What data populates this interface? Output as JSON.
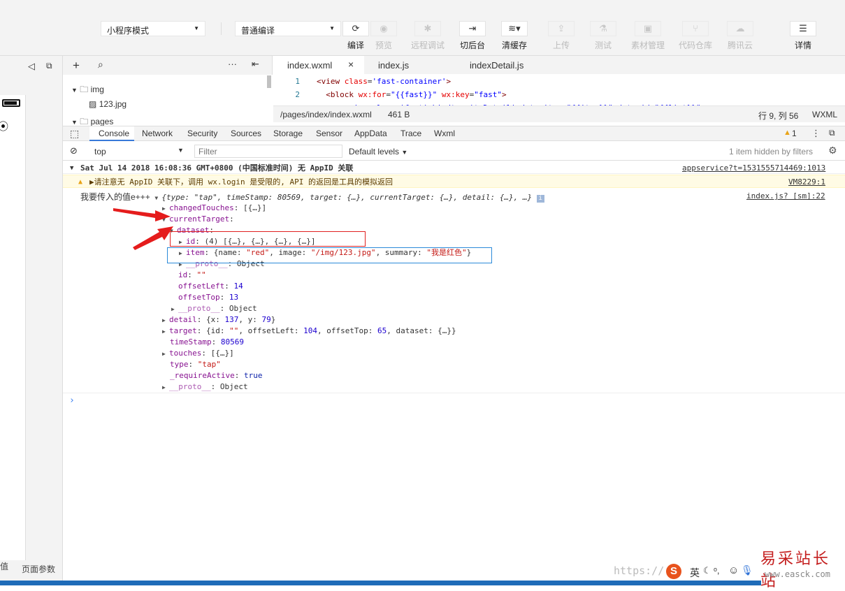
{
  "toolbar": {
    "mode_select": "小程序模式",
    "compile_select": "普通编译",
    "buttons": [
      {
        "label": "编译",
        "icon": "refresh-icon"
      },
      {
        "label": "预览",
        "icon": "eye-icon"
      },
      {
        "label": "远程调试",
        "icon": "bug-icon"
      },
      {
        "label": "切后台",
        "icon": "switch-background-icon"
      },
      {
        "label": "清缓存",
        "icon": "layers-icon"
      },
      {
        "label": "上传",
        "icon": "upload-icon"
      },
      {
        "label": "测试",
        "icon": "flask-icon"
      },
      {
        "label": "素材管理",
        "icon": "folder-icon"
      },
      {
        "label": "代码仓库",
        "icon": "branch-icon"
      },
      {
        "label": "腾讯云",
        "icon": "cloud-icon"
      },
      {
        "label": "详情",
        "icon": "menu-icon"
      }
    ]
  },
  "filetree": {
    "items": [
      {
        "name": "img",
        "type": "folder"
      },
      {
        "name": "123.jpg",
        "type": "image"
      },
      {
        "name": "pages",
        "type": "folder"
      }
    ]
  },
  "editor": {
    "tabs": [
      "index.wxml",
      "index.js",
      "indexDetail.js"
    ],
    "close_glyph": "×",
    "lines": [
      {
        "no": "1",
        "code": "<view class='fast-container'>"
      },
      {
        "no": "2",
        "code": "  <block wx:for=\"{{fast}}\" wx:key=\"fast\">"
      }
    ],
    "status": {
      "path": "/pages/index/index.wxml",
      "size": "461 B",
      "position": "行 9, 列 56",
      "lang": "WXML"
    }
  },
  "devtools": {
    "tabs": [
      "Console",
      "Network",
      "Security",
      "Sources",
      "Storage",
      "Sensor",
      "AppData",
      "Trace",
      "Wxml"
    ],
    "active_tab": "Console",
    "warning_count": "1",
    "context": "top",
    "filter_placeholder": "Filter",
    "levels": "Default levels",
    "hidden_note": "1 item hidden by filters",
    "group_header": "Sat Jul 14 2018 16:08:36 GMT+0800 (中国标准时间) 无 AppID 关联",
    "group_source": "appservice?t=1531555714469:1013",
    "warning_msg_prefix": "请注意无 AppID 关联下，调用",
    "warning_msg_code": "wx.login",
    "warning_msg_suffix": "是受限的, API 的返回是工具的模拟返回",
    "warning_source": "VM8229:1",
    "log_prefix": "我要传入的值e+++",
    "log_summary": "{type: \"tap\", timeStamp: 80569, target: {…}, currentTarget: {…}, detail: {…}, …}",
    "log_source": "index.js? [sm]:22"
  },
  "sidebar": {
    "bottom_left": "值",
    "bottom_tab": "页面参数"
  },
  "watermark": {
    "text": "易采站长站",
    "url": "www.easck.com",
    "url_partial": "https://"
  },
  "ime": {
    "lang": "英"
  }
}
